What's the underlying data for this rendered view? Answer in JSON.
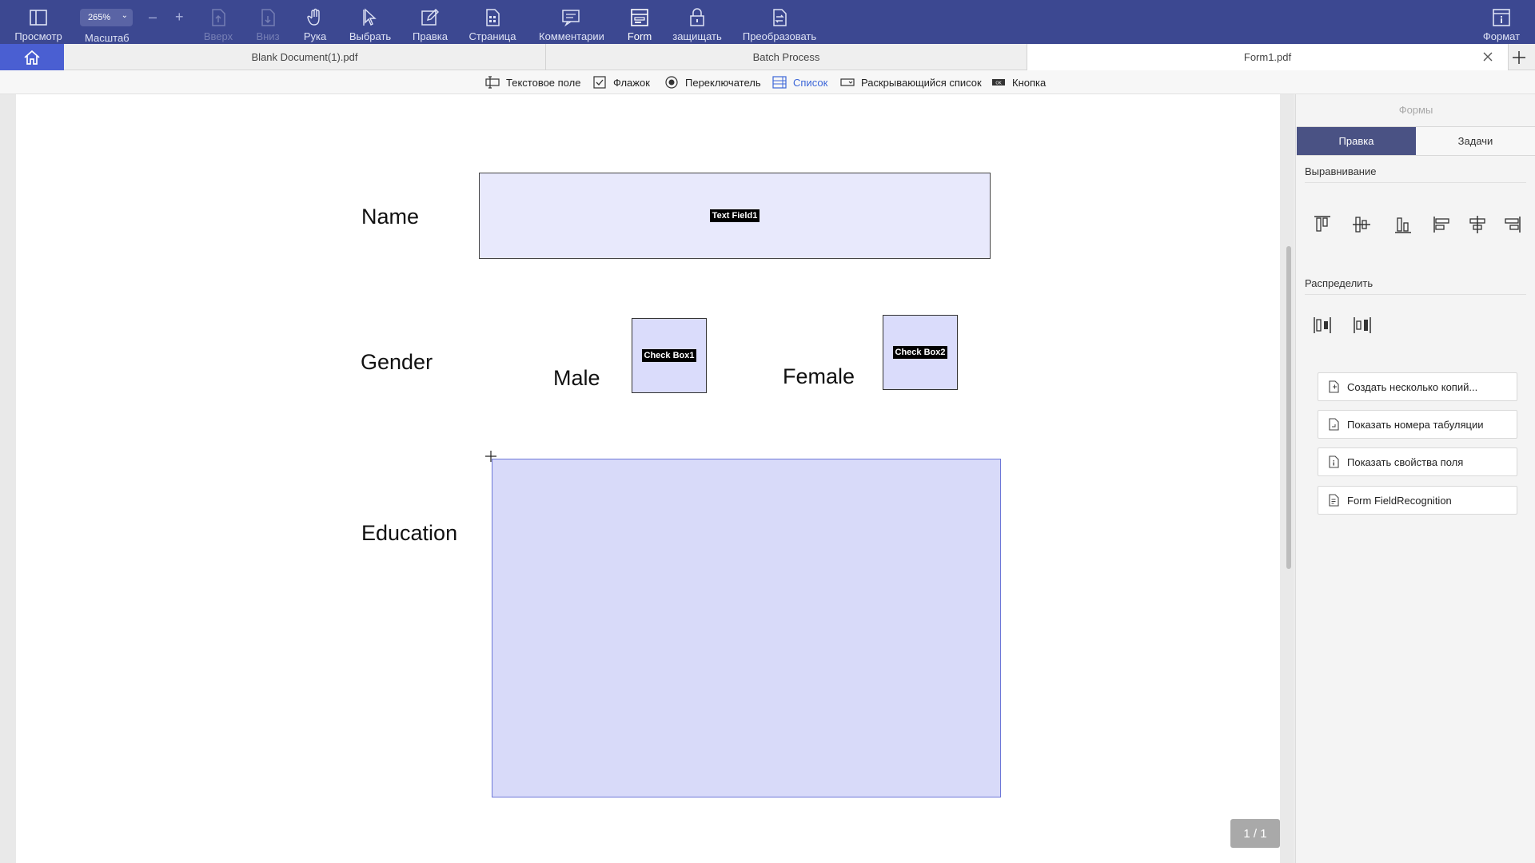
{
  "toolbar": {
    "view": "Просмотр",
    "zoom_value": "265%",
    "zoom_label": "Масштаб",
    "zoom_minus": "–",
    "zoom_plus": "+",
    "up": "Вверх",
    "down": "Вниз",
    "hand": "Рука",
    "select": "Выбрать",
    "edit": "Правка",
    "page": "Страница",
    "comments": "Комментарии",
    "form": "Form",
    "protect": "защищать",
    "convert": "Преобразовать",
    "format": "Формат"
  },
  "tabs": [
    {
      "label": "Blank Document(1).pdf"
    },
    {
      "label": "Batch Process"
    },
    {
      "label": "Form1.pdf"
    }
  ],
  "form_tools": {
    "text_field": "Текстовое поле",
    "checkbox": "Флажок",
    "radio": "Переключатель",
    "list": "Список",
    "dropdown": "Раскрывающийся список",
    "button": "Кнопка"
  },
  "document": {
    "name_label": "Name",
    "gender_label": "Gender",
    "male_label": "Male",
    "female_label": "Female",
    "education_label": "Education",
    "text_field_tag": "Text Field1",
    "check_box1_tag": "Check Box1",
    "check_box2_tag": "Check Box2"
  },
  "page_indicator": "1 / 1",
  "panel": {
    "title": "Формы",
    "tab_edit": "Правка",
    "tab_tasks": "Задачи",
    "align_section": "Выравнивание",
    "distribute_section": "Распределить",
    "buttons": [
      "Создать несколько копий...",
      "Показать номера табуляции",
      "Показать свойства поля",
      "Form FieldRecognition"
    ]
  },
  "colors": {
    "toolbar_bg": "#3c4891",
    "home_tab_bg": "#4a5fd2",
    "active_panel_tab": "#4a5284",
    "active_tool_text": "#3c66d8",
    "text_field_fill": "#e8e9fc",
    "list_field_fill": "#d8daf9"
  }
}
